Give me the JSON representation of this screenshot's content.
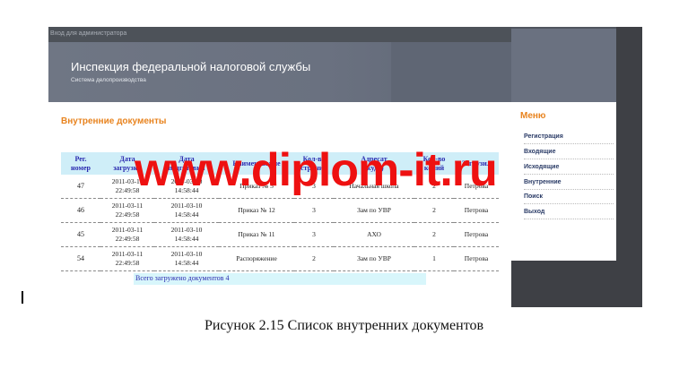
{
  "topbar": {
    "admin_link": "Вход для администратора"
  },
  "header": {
    "title": "Инспекция федеральной налоговой службы",
    "subtitle": "Система делопроизводства"
  },
  "main": {
    "page_title": "Внутренние документы",
    "table": {
      "columns": [
        [
          "Рег.",
          "номер"
        ],
        [
          "Дата",
          "загрузки"
        ],
        [
          "Дата",
          "подготовки"
        ],
        [
          "Наименование",
          ""
        ],
        [
          "Кол-во",
          "страниц"
        ],
        [
          "Адресат",
          "(куда)"
        ],
        [
          "Кол-во",
          "копий"
        ],
        [
          "Загрузил",
          ""
        ]
      ],
      "rows": [
        {
          "reg": "47",
          "upload_date": "2011-03-11",
          "upload_time": "22:49:58",
          "prep_date": "2011-03-10",
          "prep_time": "14:58:44",
          "name": "Приказ № 5",
          "pages": "3",
          "addressee": "Начальная школа",
          "copies": "2",
          "uploaded_by": "Петрова"
        },
        {
          "reg": "46",
          "upload_date": "2011-03-11",
          "upload_time": "22:49:58",
          "prep_date": "2011-03-10",
          "prep_time": "14:58:44",
          "name": "Приказ № 12",
          "pages": "3",
          "addressee": "Зам по УВР",
          "copies": "2",
          "uploaded_by": "Петрова"
        },
        {
          "reg": "45",
          "upload_date": "2011-03-11",
          "upload_time": "22:49:58",
          "prep_date": "2011-03-10",
          "prep_time": "14:58:44",
          "name": "Приказ № 11",
          "pages": "3",
          "addressee": "АХО",
          "copies": "2",
          "uploaded_by": "Петрова"
        },
        {
          "reg": "54",
          "upload_date": "2011-03-11",
          "upload_time": "22:49:58",
          "prep_date": "2011-03-10",
          "prep_time": "14:58:44",
          "name": "Распоряжение",
          "pages": "2",
          "addressee": "Зам по УВР",
          "copies": "1",
          "uploaded_by": "Петрова"
        }
      ]
    },
    "total_text": "Всего загружено документов 4"
  },
  "sidebar": {
    "title": "Меню",
    "items": [
      "Регистрация",
      "Входящие",
      "Исходящие",
      "Внутренние",
      "Поиск",
      "Выход"
    ]
  },
  "watermark": "www.diplom-it.ru",
  "caption": "Рисунок 2.15 Список внутренних документов",
  "colors": {
    "accent": "#e8831e",
    "link": "#2b2bb0",
    "header_bg": "#6a7180",
    "watermark": "#ee1111"
  }
}
